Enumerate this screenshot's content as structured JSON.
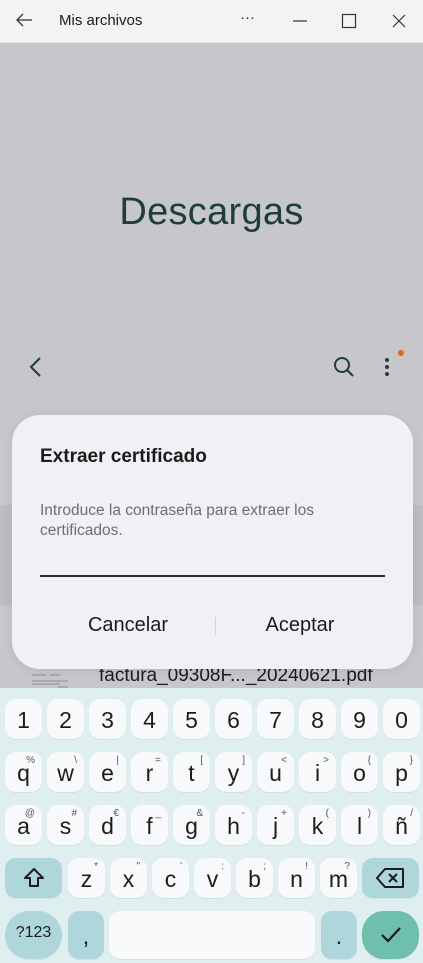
{
  "window": {
    "title": "Mis archivos",
    "more_label": "···"
  },
  "app": {
    "heading": "Descargas",
    "file_name": "factura_09308F..._20240621.pdf",
    "notification_dot_color": "#e8632a"
  },
  "dialog": {
    "title": "Extraer certificado",
    "message": "Introduce la contraseña para extraer los certificados.",
    "password_value": "",
    "cancel_label": "Cancelar",
    "accept_label": "Aceptar"
  },
  "keyboard": {
    "number_row": [
      {
        "label": "1"
      },
      {
        "label": "2"
      },
      {
        "label": "3"
      },
      {
        "label": "4"
      },
      {
        "label": "5"
      },
      {
        "label": "6"
      },
      {
        "label": "7"
      },
      {
        "label": "8"
      },
      {
        "label": "9"
      },
      {
        "label": "0"
      }
    ],
    "row1": [
      {
        "label": "q",
        "sup": "%"
      },
      {
        "label": "w",
        "sup": "\\"
      },
      {
        "label": "e",
        "sup": "|"
      },
      {
        "label": "r",
        "sup": "="
      },
      {
        "label": "t",
        "sup": "["
      },
      {
        "label": "y",
        "sup": "]"
      },
      {
        "label": "u",
        "sup": "<"
      },
      {
        "label": "i",
        "sup": ">"
      },
      {
        "label": "o",
        "sup": "{"
      },
      {
        "label": "p",
        "sup": "}"
      }
    ],
    "row2": [
      {
        "label": "a",
        "sup": "@"
      },
      {
        "label": "s",
        "sup": "#"
      },
      {
        "label": "d",
        "sup": "€"
      },
      {
        "label": "f",
        "sup": "_"
      },
      {
        "label": "g",
        "sup": "&"
      },
      {
        "label": "h",
        "sup": "-"
      },
      {
        "label": "j",
        "sup": "+"
      },
      {
        "label": "k",
        "sup": "("
      },
      {
        "label": "l",
        "sup": ")"
      },
      {
        "label": "ñ",
        "sup": "/"
      }
    ],
    "row3": [
      {
        "label": "z",
        "sup": "*"
      },
      {
        "label": "x",
        "sup": "\""
      },
      {
        "label": "c",
        "sup": "'"
      },
      {
        "label": "v",
        "sup": ":"
      },
      {
        "label": "b",
        "sup": ";"
      },
      {
        "label": "n",
        "sup": "!"
      },
      {
        "label": "m",
        "sup": "?"
      }
    ],
    "symbols_label": "?123",
    "comma_label": ",",
    "period_label": ".",
    "colors": {
      "key": "#f8f9fb",
      "special": "#aed6db",
      "enter": "#6ebfae",
      "background": "#dfeeee"
    }
  }
}
